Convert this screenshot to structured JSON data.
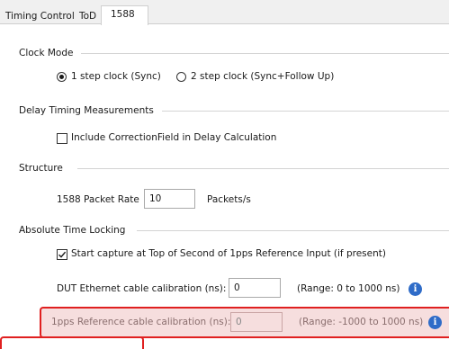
{
  "tabs": [
    {
      "label": "Timing Control",
      "active": false
    },
    {
      "label": "ToD",
      "active": false
    },
    {
      "label": "1588",
      "active": true
    }
  ],
  "clock_mode": {
    "title": "Clock Mode",
    "options": [
      {
        "label": "1 step clock (Sync)",
        "selected": true
      },
      {
        "label": "2 step clock (Sync+Follow Up)",
        "selected": false
      }
    ]
  },
  "delay_timing": {
    "title": "Delay Timing Measurements",
    "checkbox_label": "Include CorrectionField in Delay Calculation",
    "checked": false
  },
  "structure": {
    "title": "Structure",
    "packet_rate_label": "1588 Packet Rate",
    "packet_rate_value": "10",
    "packet_rate_unit": "Packets/s"
  },
  "absolute_time": {
    "title": "Absolute Time Locking",
    "start_capture_label": "Start capture at Top of Second of 1pps Reference Input (if present)",
    "start_capture_checked": true,
    "dut_cal_label": "DUT Ethernet cable calibration (ns):",
    "dut_cal_value": "0",
    "dut_cal_range": "(Range: 0 to 1000 ns)",
    "pps_cal_label": "1pps Reference cable calibration (ns):",
    "pps_cal_value": "0",
    "pps_cal_range": "(Range: -1000 to 1000 ns)"
  },
  "icons": {
    "info": "info-icon"
  },
  "colors": {
    "highlight_border": "#e02020",
    "highlight_fill": "#f6dede",
    "info_blue": "#2f6cc8"
  }
}
